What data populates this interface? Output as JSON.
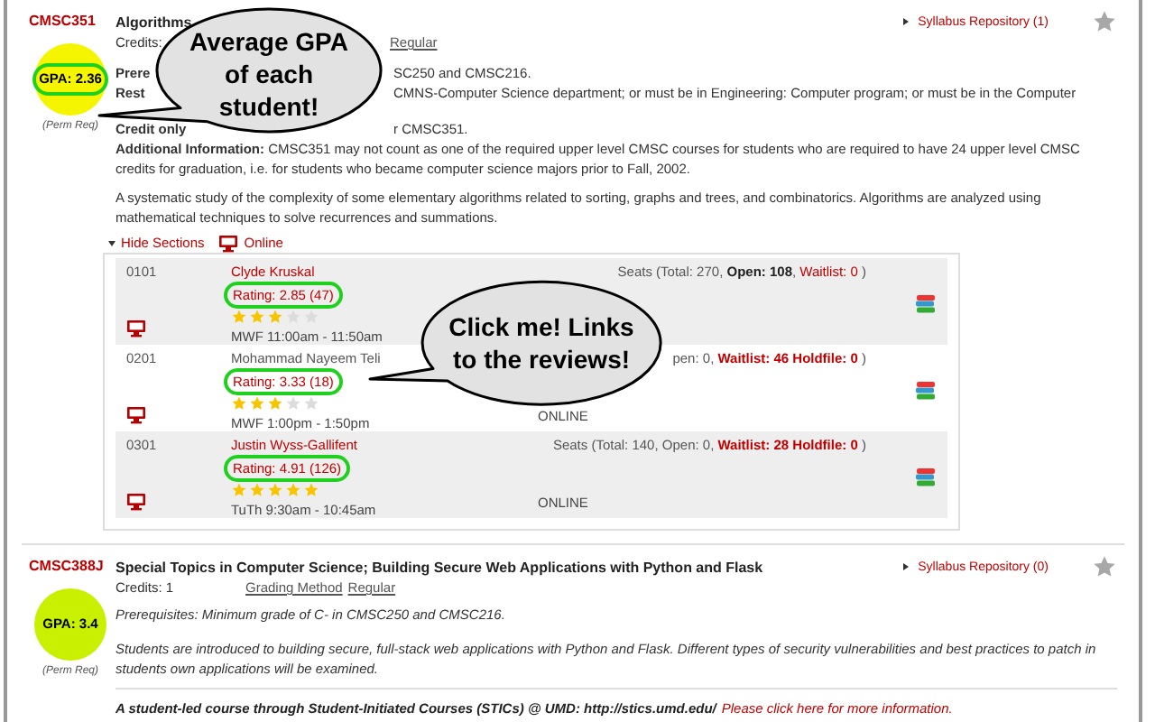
{
  "courses": [
    {
      "code": "CMSC351",
      "gpa": {
        "label": "GPA: 2.36",
        "color": "#f5f500",
        "circled": true
      },
      "perm_note": "(Perm Req)",
      "title": "Algorithms",
      "syllabus": "Syllabus Repository (1)",
      "favorite": false,
      "credits": "Credits:",
      "grading_value": "Regular",
      "partial_lines": [
        {
          "label": "Prere",
          "text": "SC250 and CMSC216."
        },
        {
          "label": "Rest",
          "text": "CMNS-Computer Science department; or must be in Engineering: Computer program; or must be in the Computer"
        },
        {
          "label": "Credit only",
          "text": "r CMSC351."
        }
      ],
      "additional": "**Additional Information:** CMSC351 may not count as one of the required upper level CMSC courses for students who are required to have 24 upper level CMSC credits for graduation, i.e. for students who became computer science majors prior to Fall, 2002.",
      "description": "A systematic study of the complexity of some elementary algorithms related to sorting, graphs and trees, and combinatorics. Algorithms are analyzed using mathematical techniques to solve recurrences and summations.",
      "sections_toggle": "Hide Sections",
      "delivery": "Online",
      "sections": [
        {
          "number": "0101",
          "instructor": "Clyde Kruskal",
          "linked": true,
          "rating": "Rating: 2.85 (47)",
          "circled": true,
          "stars": 3,
          "time": "MWF 11:00am - 11:50am",
          "seats": [
            {
              "kind": "plain",
              "text": "Seats (Total: 270, "
            },
            {
              "kind": "bold",
              "text": "Open: 108"
            },
            {
              "kind": "plain",
              "text": ", "
            },
            {
              "kind": "waitlist",
              "text": "Waitlist: 0"
            },
            {
              "kind": "plain",
              "text": " )"
            }
          ]
        },
        {
          "number": "0201",
          "instructor": "Mohammad Nayeem Teli",
          "linked": false,
          "rating": "Rating: 3.33 (18)",
          "circled": true,
          "stars": 3,
          "time": "MWF 1:00pm - 1:50pm",
          "location": "ONLINE",
          "seats": [
            {
              "kind": "plain",
              "text": "pen: 0, "
            },
            {
              "kind": "alert",
              "text": "Waitlist: 46 Holdfile: 0"
            },
            {
              "kind": "plain",
              "text": " )"
            }
          ]
        },
        {
          "number": "0301",
          "instructor": "Justin Wyss-Gallifent",
          "linked": true,
          "rating": "Rating: 4.91 (126)",
          "circled": true,
          "stars": 5,
          "time": "TuTh 9:30am - 10:45am",
          "location": "ONLINE",
          "seats": [
            {
              "kind": "plain",
              "text": "Seats (Total: 140, Open: 0, "
            },
            {
              "kind": "alert",
              "text": "Waitlist: 28 Holdfile: 0"
            },
            {
              "kind": "plain",
              "text": " )"
            }
          ]
        }
      ]
    },
    {
      "code": "CMSC388J",
      "gpa": {
        "label": "GPA: 3.4",
        "color": "#c8f000",
        "circled": false
      },
      "perm_note": "(Perm Req)",
      "title": "Special Topics in Computer Science; Building Secure Web Applications with Python and Flask",
      "syllabus": "Syllabus Repository (0)",
      "favorite": false,
      "credits": "Credits: 1",
      "grading_label": "Grading Method",
      "grading_value": "Regular",
      "prerequisites": "Prerequisites: Minimum grade of C- in CMSC250 and CMSC216.",
      "description": "Students are introduced to building secure, full-stack web applications with Python and Flask. Different types of security vulnerabilities and best practices to patch in students own applications will be examined.",
      "note": "A student-led course through Student-Initiated Courses (STICs) @ UMD: http://stics.umd.edu/",
      "note_link": "Please click here for more information."
    }
  ],
  "annotations": [
    {
      "text": "Average GPA of each student!"
    },
    {
      "text": "Click me! Links to the reviews!"
    }
  ]
}
